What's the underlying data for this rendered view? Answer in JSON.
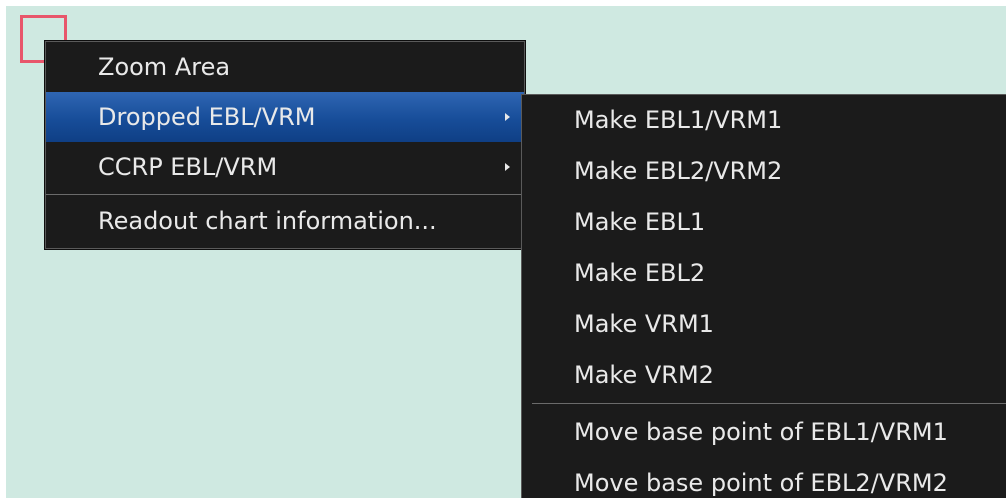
{
  "main_menu": {
    "items": [
      {
        "label": "Zoom Area"
      },
      {
        "label": "Dropped EBL/VRM"
      },
      {
        "label": "CCRP EBL/VRM"
      },
      {
        "label": "Readout chart information..."
      }
    ]
  },
  "sub_menu": {
    "items": [
      {
        "label": "Make EBL1/VRM1"
      },
      {
        "label": "Make EBL2/VRM2"
      },
      {
        "label": "Make EBL1"
      },
      {
        "label": "Make EBL2"
      },
      {
        "label": "Make VRM1"
      },
      {
        "label": "Make VRM2"
      },
      {
        "label": "Move base point of EBL1/VRM1"
      },
      {
        "label": "Move base point of EBL2/VRM2"
      }
    ]
  },
  "colors": {
    "canvas_background": "#cfe9e1",
    "menu_background": "#1b1b1b",
    "highlight": "#174d99",
    "cursor_marker": "#e8566b",
    "text": "#e9e9e9"
  },
  "icons": {
    "submenu_arrow": "chevron-right-icon",
    "cursor_marker": "square-cursor-icon"
  }
}
